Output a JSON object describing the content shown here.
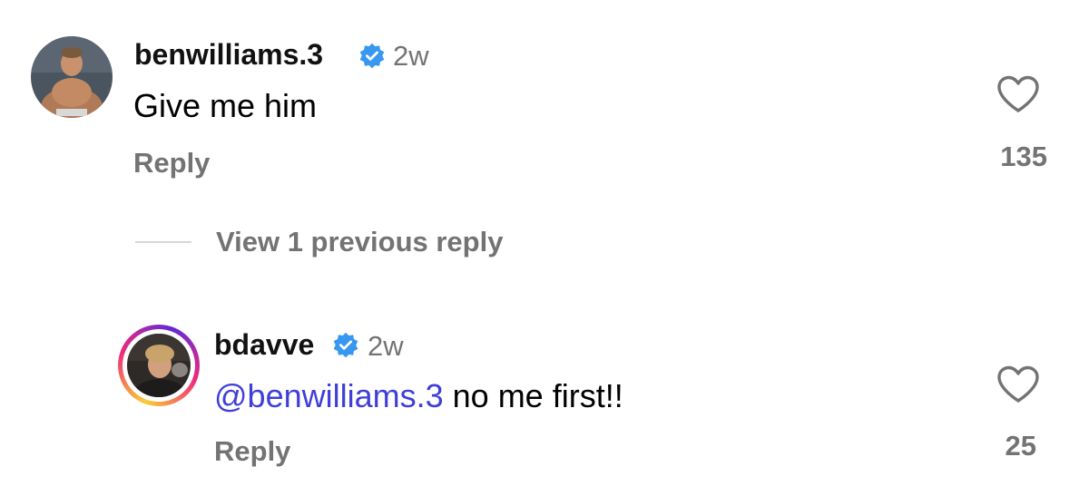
{
  "comments": [
    {
      "username": "benwilliams.3",
      "verified": true,
      "timestamp": "2w",
      "text": "Give me him",
      "reply_label": "Reply",
      "likes": "135",
      "avatar_icon": "user-avatar",
      "has_story_ring": false
    },
    {
      "username": "bdavve",
      "verified": true,
      "timestamp": "2w",
      "mention": "@benwilliams.3",
      "text": " no me first!!",
      "reply_label": "Reply",
      "likes": "25",
      "avatar_icon": "user-avatar",
      "has_story_ring": true
    }
  ],
  "thread": {
    "view_replies_label": "View 1 previous reply"
  },
  "colors": {
    "verified_badge": "#3897f0",
    "mention": "#3f3fd8",
    "muted_text": "#737373",
    "story_ring_start": "#f9ce34",
    "story_ring_mid": "#ee2a7b",
    "story_ring_end": "#6228d7"
  }
}
